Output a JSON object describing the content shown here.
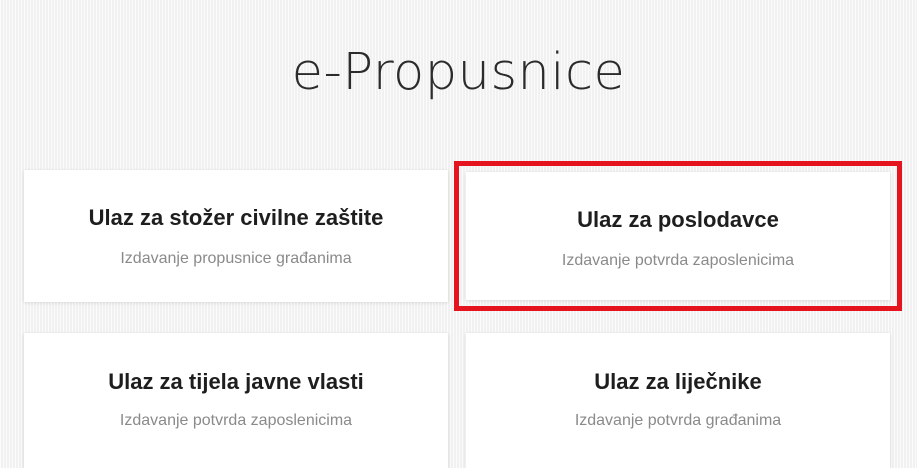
{
  "header": {
    "title": "e-Propusnice"
  },
  "cards": [
    {
      "title": "Ulaz za stožer civilne zaštite",
      "subtitle": "Izdavanje propusnice građanima"
    },
    {
      "title": "Ulaz za poslodavce",
      "subtitle": "Izdavanje potvrda zaposlenicima"
    },
    {
      "title": "Ulaz za tijela javne vlasti",
      "subtitle": "Izdavanje potvrda zaposlenicima"
    },
    {
      "title": "Ulaz za liječnike",
      "subtitle": "Izdavanje potvrda građanima"
    }
  ],
  "colors": {
    "highlight": "#e4151f",
    "card_background": "#ffffff",
    "page_background": "#f6f6f6",
    "title_text": "#1e1e1e",
    "subtitle_text": "#8a8a8a"
  }
}
